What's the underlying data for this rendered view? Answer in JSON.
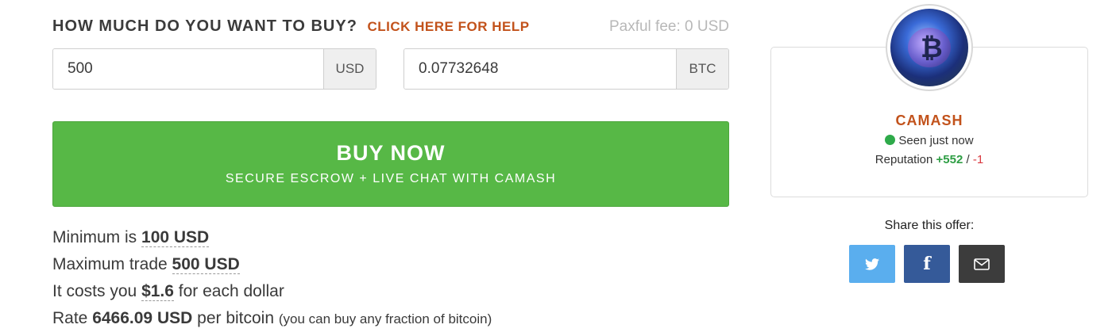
{
  "form": {
    "question": "HOW MUCH DO YOU WANT TO BUY?",
    "help_link": "CLICK HERE FOR HELP",
    "fee": "Paxful fee: 0 USD",
    "usd_value": "500",
    "usd_label": "USD",
    "btc_value": "0.07732648",
    "btc_label": "BTC"
  },
  "buy_button": {
    "label": "BUY NOW",
    "sub_label": "SECURE ESCROW + LIVE CHAT WITH CAMASH",
    "color": "#57b846"
  },
  "info": {
    "min_prefix": "Minimum is",
    "min_value": "100 USD",
    "max_prefix": "Maximum trade",
    "max_value": "500 USD",
    "cost_prefix": "It costs you",
    "cost_value": "$1.6",
    "cost_suffix": "for each dollar",
    "rate_prefix": "Rate",
    "rate_value": "6466.09 USD",
    "rate_suffix": "per bitcoin",
    "rate_note": "(you can buy any fraction of bitcoin)"
  },
  "seller": {
    "name": "CAMASH",
    "status": "Seen just now",
    "status_color": "#2eaa4a",
    "reputation_label": "Reputation",
    "reputation_positive": "+552",
    "reputation_separator": "/",
    "reputation_negative": "-1"
  },
  "share": {
    "label": "Share this offer:",
    "buttons": [
      {
        "icon": "twitter-icon",
        "color": "#5aaeee"
      },
      {
        "icon": "facebook-icon",
        "glyph": "f",
        "color": "#355a99"
      },
      {
        "icon": "email-icon",
        "color": "#3c3c3c"
      }
    ]
  },
  "colors": {
    "accent": "#c2521b",
    "muted": "#b8b8b8"
  }
}
